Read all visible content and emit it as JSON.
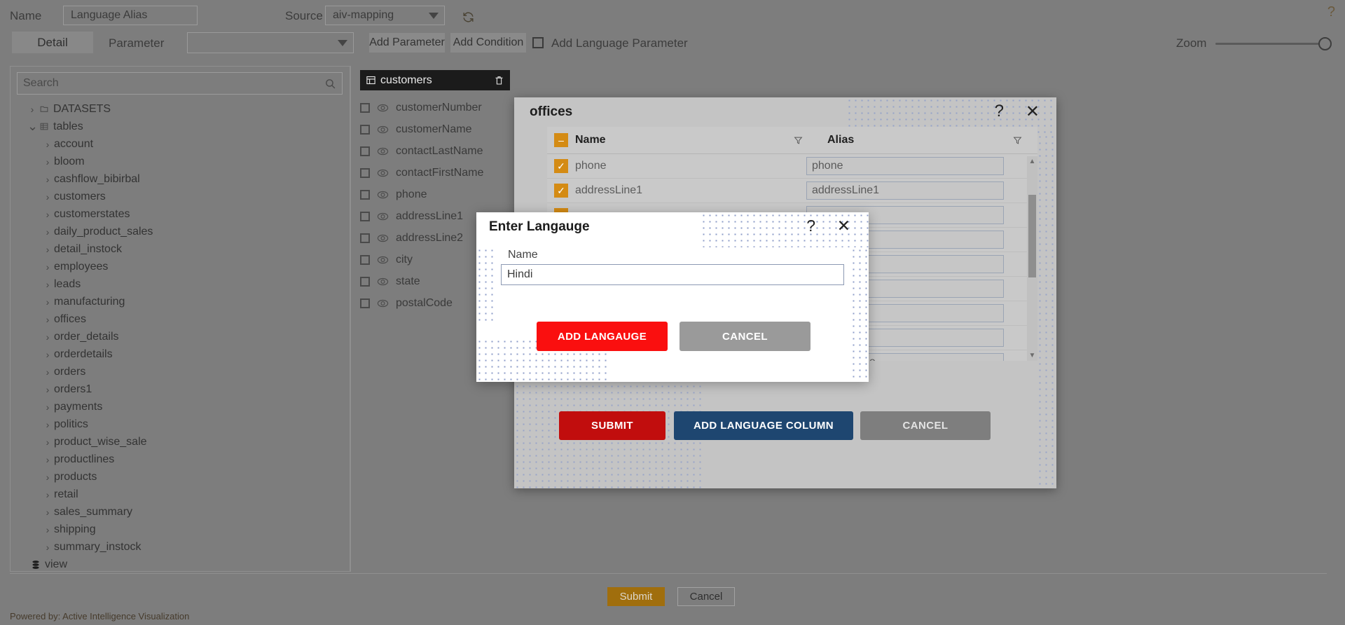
{
  "header": {
    "name_label": "Name",
    "name_value": "Language Alias",
    "source_label": "Source",
    "source_value": "aiv-mapping",
    "refresh_icon": "refresh-icon",
    "help_icon": "?"
  },
  "toolbar": {
    "detail_tab": "Detail",
    "parameter_label": "Parameter",
    "parameter_value": "",
    "add_parameter": "Add Parameter",
    "add_condition": "Add Condition",
    "add_language_parameter": "Add Language Parameter",
    "zoom_label": "Zoom",
    "zoom_value": 100
  },
  "sidebar": {
    "search_placeholder": "Search",
    "search_icon": "search-icon",
    "tree": [
      {
        "label": "DATASETS",
        "level": 0,
        "expanded": false,
        "icon": "folder-icon"
      },
      {
        "label": "tables",
        "level": 0,
        "expanded": true,
        "icon": "table-icon"
      },
      {
        "label": "account",
        "level": 1,
        "expanded": false,
        "icon": ""
      },
      {
        "label": "bloom",
        "level": 1,
        "expanded": false,
        "icon": ""
      },
      {
        "label": "cashflow_bibirbal",
        "level": 1,
        "expanded": false,
        "icon": ""
      },
      {
        "label": "customers",
        "level": 1,
        "expanded": false,
        "icon": ""
      },
      {
        "label": "customerstates",
        "level": 1,
        "expanded": false,
        "icon": ""
      },
      {
        "label": "daily_product_sales",
        "level": 1,
        "expanded": false,
        "icon": ""
      },
      {
        "label": "detail_instock",
        "level": 1,
        "expanded": false,
        "icon": ""
      },
      {
        "label": "employees",
        "level": 1,
        "expanded": false,
        "icon": ""
      },
      {
        "label": "leads",
        "level": 1,
        "expanded": false,
        "icon": ""
      },
      {
        "label": "manufacturing",
        "level": 1,
        "expanded": false,
        "icon": ""
      },
      {
        "label": "offices",
        "level": 1,
        "expanded": false,
        "icon": ""
      },
      {
        "label": "order_details",
        "level": 1,
        "expanded": false,
        "icon": ""
      },
      {
        "label": "orderdetails",
        "level": 1,
        "expanded": false,
        "icon": ""
      },
      {
        "label": "orders",
        "level": 1,
        "expanded": false,
        "icon": ""
      },
      {
        "label": "orders1",
        "level": 1,
        "expanded": false,
        "icon": ""
      },
      {
        "label": "payments",
        "level": 1,
        "expanded": false,
        "icon": ""
      },
      {
        "label": "politics",
        "level": 1,
        "expanded": false,
        "icon": ""
      },
      {
        "label": "product_wise_sale",
        "level": 1,
        "expanded": false,
        "icon": ""
      },
      {
        "label": "productlines",
        "level": 1,
        "expanded": false,
        "icon": ""
      },
      {
        "label": "products",
        "level": 1,
        "expanded": false,
        "icon": ""
      },
      {
        "label": "retail",
        "level": 1,
        "expanded": false,
        "icon": ""
      },
      {
        "label": "sales_summary",
        "level": 1,
        "expanded": false,
        "icon": ""
      },
      {
        "label": "shipping",
        "level": 1,
        "expanded": false,
        "icon": ""
      },
      {
        "label": "summary_instock",
        "level": 1,
        "expanded": false,
        "icon": ""
      },
      {
        "label": "view",
        "level": 0,
        "expanded": null,
        "icon": "database-icon"
      }
    ]
  },
  "customers_card": {
    "title": "customers",
    "table_icon": "table-icon",
    "delete_icon": "trash-icon",
    "columns": [
      {
        "name": "customerNumber",
        "checked": false
      },
      {
        "name": "customerName",
        "checked": false
      },
      {
        "name": "contactLastName",
        "checked": false
      },
      {
        "name": "contactFirstName",
        "checked": false
      },
      {
        "name": "phone",
        "checked": false
      },
      {
        "name": "addressLine1",
        "checked": false
      },
      {
        "name": "addressLine2",
        "checked": false
      },
      {
        "name": "city",
        "checked": false
      },
      {
        "name": "state",
        "checked": false
      },
      {
        "name": "postalCode",
        "checked": false
      }
    ]
  },
  "offices_modal": {
    "title": "offices",
    "help_icon": "?",
    "close_icon": "✕",
    "header_checkbox_state": "indeterminate",
    "columns": [
      {
        "label": "Name",
        "filter_icon": "filter-icon"
      },
      {
        "label": "Alias",
        "filter_icon": "filter-icon"
      }
    ],
    "rows": [
      {
        "name": "phone",
        "alias": "phone",
        "checked": true
      },
      {
        "name": "addressLine1",
        "alias": "addressLine1",
        "checked": true
      },
      {
        "name": "",
        "alias": "",
        "checked": true
      },
      {
        "name": "",
        "alias": "",
        "checked": true
      },
      {
        "name": "",
        "alias": "",
        "checked": true
      },
      {
        "name": "",
        "alias": "",
        "checked": true
      },
      {
        "name": "",
        "alias": "",
        "checked": true
      },
      {
        "name": "",
        "alias": "",
        "checked": true
      },
      {
        "name": "countryCode",
        "alias": "countryCode",
        "checked": true
      }
    ],
    "buttons": {
      "submit": "SUBMIT",
      "add_language_column": "ADD LANGUAGE COLUMN",
      "cancel": "CANCEL"
    },
    "scrollbar": {
      "up_icon": "▲",
      "down_icon": "▼"
    }
  },
  "language_modal": {
    "title": "Enter Langauge",
    "help_icon": "?",
    "close_icon": "✕",
    "name_label": "Name",
    "name_value": "Hindi",
    "add_button": "ADD LANGAUGE",
    "cancel_button": "CANCEL"
  },
  "footer": {
    "submit": "Submit",
    "cancel": "Cancel",
    "powered_by": "Powered by: Active Intelligence Visualization"
  },
  "colors": {
    "accent_orange": "#d48b14",
    "danger_red": "#c10d0d",
    "bright_red": "#fa0f0f",
    "navy": "#1e4670",
    "gray_btn": "#7e7e7e",
    "footer_submit": "#a06e0d",
    "app_bg": "#7d7d7d",
    "modal_bg": "#c4c4c4"
  }
}
